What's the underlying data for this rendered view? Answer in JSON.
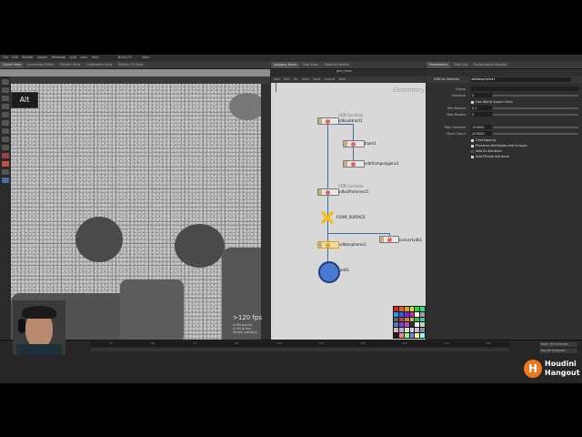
{
  "menu": [
    "File",
    "Edit",
    "Render",
    "Assets",
    "Windows",
    "qLib",
    "Labs",
    "Help",
    "Build_FX",
    "Main"
  ],
  "left_tabs": [
    "Scene View",
    "Animation Editor",
    "Render View",
    "Composite View",
    "Motion FX View"
  ],
  "network_tabs": [
    "/obj/geo_foam",
    "Tree View",
    "Material Palette"
  ],
  "param_tabs": [
    "Parameters",
    "Take List",
    "Performance Monitor"
  ],
  "network_header": {
    "path": "geo_foam",
    "menu": [
      "Add",
      "Edit",
      "Go",
      "View",
      "Tools",
      "Layout",
      "Help"
    ]
  },
  "viewport": {
    "alt_badge": "Alt",
    "fps": ">120 fps",
    "info_lines": [
      "4.9M points",
      "4.9M prims",
      "Single (persp1)"
    ]
  },
  "network": {
    "context_label": "Geometry",
    "nodes": [
      {
        "name": "vdbsubtract1",
        "sub": "VDB Combine"
      },
      {
        "name": "foam1"
      },
      {
        "name": "vdbfrompolygons3"
      },
      {
        "name": "vdbsdfintersect1",
        "sub": "VDB Combine"
      },
      {
        "name": "FOAM_SURFACE"
      },
      {
        "name": "vdbtospheres1"
      },
      {
        "name": "convertvdb1"
      },
      {
        "name": "add1"
      }
    ]
  },
  "parameters": {
    "node_type": "VDB to Spheres",
    "node_name": "vdbtospheres1",
    "group_label": "Group",
    "rows": [
      {
        "label": "Isovalue",
        "value": "0"
      },
      {
        "label": "Min Radius",
        "value": "0.2"
      },
      {
        "label": "Max Radius",
        "value": "0"
      },
      {
        "label": "Max Spheres",
        "value": "100000"
      },
      {
        "label": "Point Count",
        "value": "400000"
      }
    ],
    "worldspace_label": "Use World Space Units",
    "checks": [
      "Overlapping",
      "Preserve Attributes and Groups",
      "Add ID Attribute",
      "Add PScale Attribute"
    ]
  },
  "timeline": {
    "ticks": [
      "24",
      "48",
      "72",
      "96",
      "120",
      "144",
      "168",
      "192",
      "216",
      "240"
    ],
    "right_buttons": [
      "Keys: 0/0 channels",
      "Key All Channels"
    ]
  },
  "palette_colors": [
    "#e02020",
    "#e06020",
    "#e0a020",
    "#e0e020",
    "#20e020",
    "#20e0a0",
    "#20a0e0",
    "#2060e0",
    "#8020e0",
    "#e020a0",
    "#ffffff",
    "#a0a0a0",
    "#606060",
    "#c04040",
    "#c08040",
    "#c0c040",
    "#40c040",
    "#40c0c0",
    "#4080c0",
    "#8040c0",
    "#c040c0",
    "#303030",
    "#f0f0f0",
    "#b0e0b0",
    "#e0b0b0",
    "#b0b0e0",
    "#e0e0b0",
    "#b0e0e0",
    "#e0b0e0",
    "#909090",
    "#202020",
    "#ff8080",
    "#80ff80",
    "#8080ff",
    "#ffff80",
    "#80ffff"
  ],
  "branding": {
    "line1": "Houdini",
    "line2": "Hangout"
  }
}
